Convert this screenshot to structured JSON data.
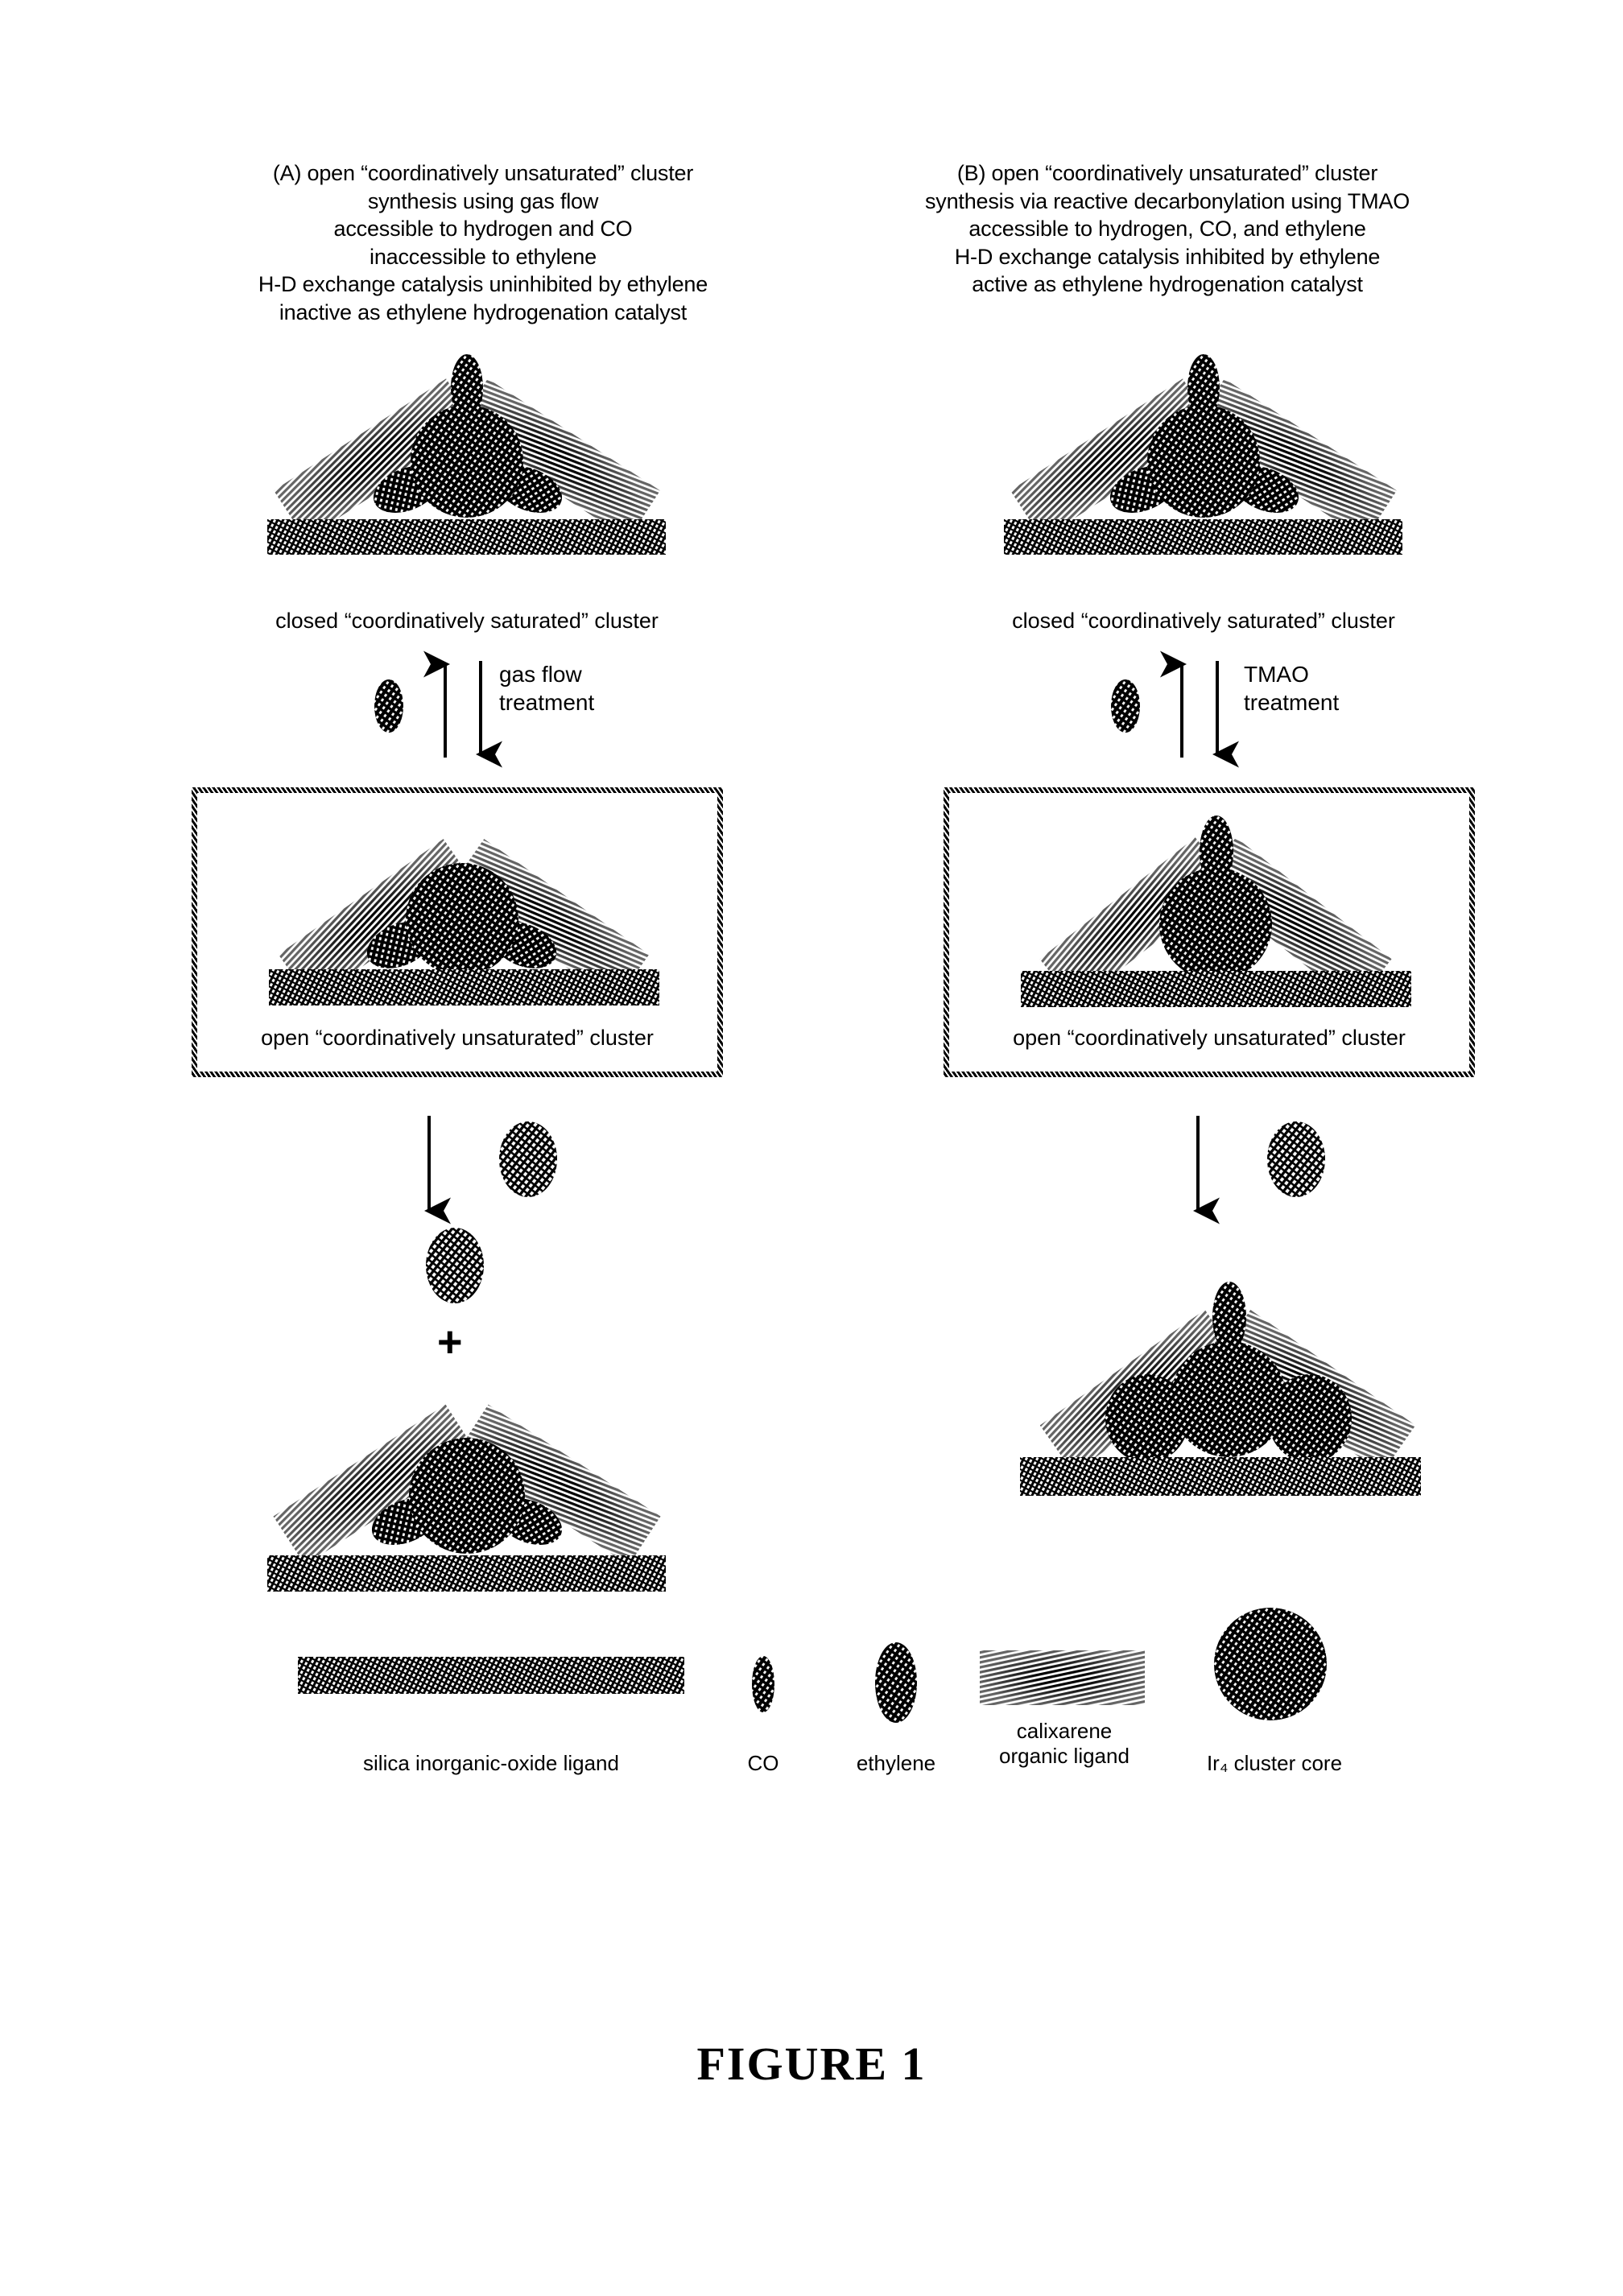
{
  "figure": {
    "caption": "FIGURE 1"
  },
  "columns": {
    "a": {
      "header": "(A) open “coordinatively unsaturated” cluster\nsynthesis using gas flow\naccessible to hydrogen and CO\ninaccessible to ethylene\nH-D exchange catalysis uninhibited by ethylene\ninactive as ethylene hydrogenation catalyst",
      "closed_cluster_label": "closed “coordinatively saturated” cluster",
      "treatment_label": "gas flow\ntreatment",
      "open_cluster_label": "open “coordinatively unsaturated” cluster",
      "plus_symbol": "+"
    },
    "b": {
      "header": "(B) open “coordinatively unsaturated” cluster\nsynthesis via reactive decarbonylation using TMAO\naccessible to hydrogen, CO, and ethylene\nH-D exchange catalysis inhibited by ethylene\nactive as ethylene hydrogenation catalyst",
      "closed_cluster_label": "closed “coordinatively saturated” cluster",
      "treatment_label": "TMAO\ntreatment",
      "open_cluster_label": "open “coordinatively unsaturated” cluster"
    }
  },
  "legend": {
    "items": [
      {
        "key": "silica",
        "label": "silica inorganic-oxide ligand",
        "icon": "hatched-bar-icon"
      },
      {
        "key": "co",
        "label": "CO",
        "icon": "small-ellipse-icon"
      },
      {
        "key": "ethylene",
        "label": "ethylene",
        "icon": "medium-ellipse-icon"
      },
      {
        "key": "calixarene",
        "label": "calixarene\norganic ligand",
        "icon": "hatched-rectangle-icon"
      },
      {
        "key": "ir4",
        "label": "Ir₄ cluster core",
        "icon": "hatched-circle-icon"
      }
    ]
  },
  "colors": {
    "ink": "#000000",
    "paper": "#ffffff"
  }
}
